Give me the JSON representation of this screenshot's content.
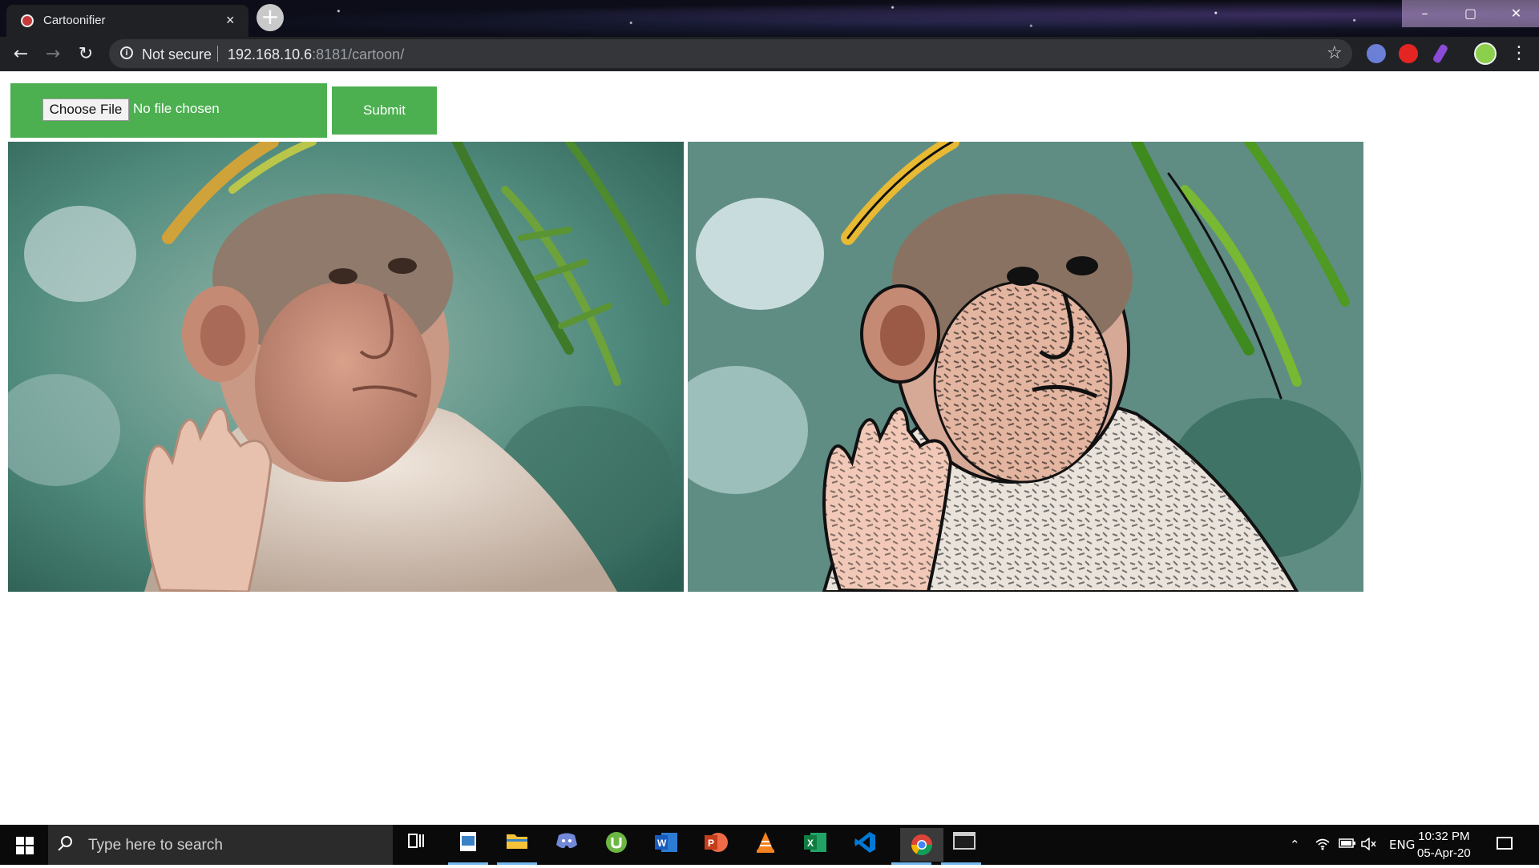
{
  "browser": {
    "tab_title": "Cartoonifier",
    "tab_close": "×",
    "new_tab": "+",
    "window_controls": {
      "minimize": "–",
      "maximize": "▢",
      "close": "✕"
    },
    "nav": {
      "back": "←",
      "forward": "→",
      "reload": "↻"
    },
    "security_label": "Not secure",
    "url_host": "192.168.10.6",
    "url_rest": ":8181/cartoon/",
    "bookmark_icon": "☆",
    "menu_icon": "⋮"
  },
  "page": {
    "file_input": {
      "button_label": "Choose File",
      "status": "No file chosen"
    },
    "submit_label": "Submit",
    "images": [
      {
        "name": "original-photo",
        "subject": "monkey"
      },
      {
        "name": "cartoonified-photo",
        "subject": "monkey"
      }
    ],
    "colors": {
      "accent": "#4caf50"
    }
  },
  "taskbar": {
    "search_placeholder": "Type here to search",
    "apps": [
      "task-view-icon",
      "photos-icon",
      "file-explorer-icon",
      "discord-icon",
      "utorrent-icon",
      "word-icon",
      "powerpoint-icon",
      "vlc-icon",
      "excel-icon",
      "vscode-icon",
      "chrome-icon",
      "terminal-icon"
    ],
    "language": "ENG",
    "time": "10:32 PM",
    "date": "05-Apr-20"
  }
}
